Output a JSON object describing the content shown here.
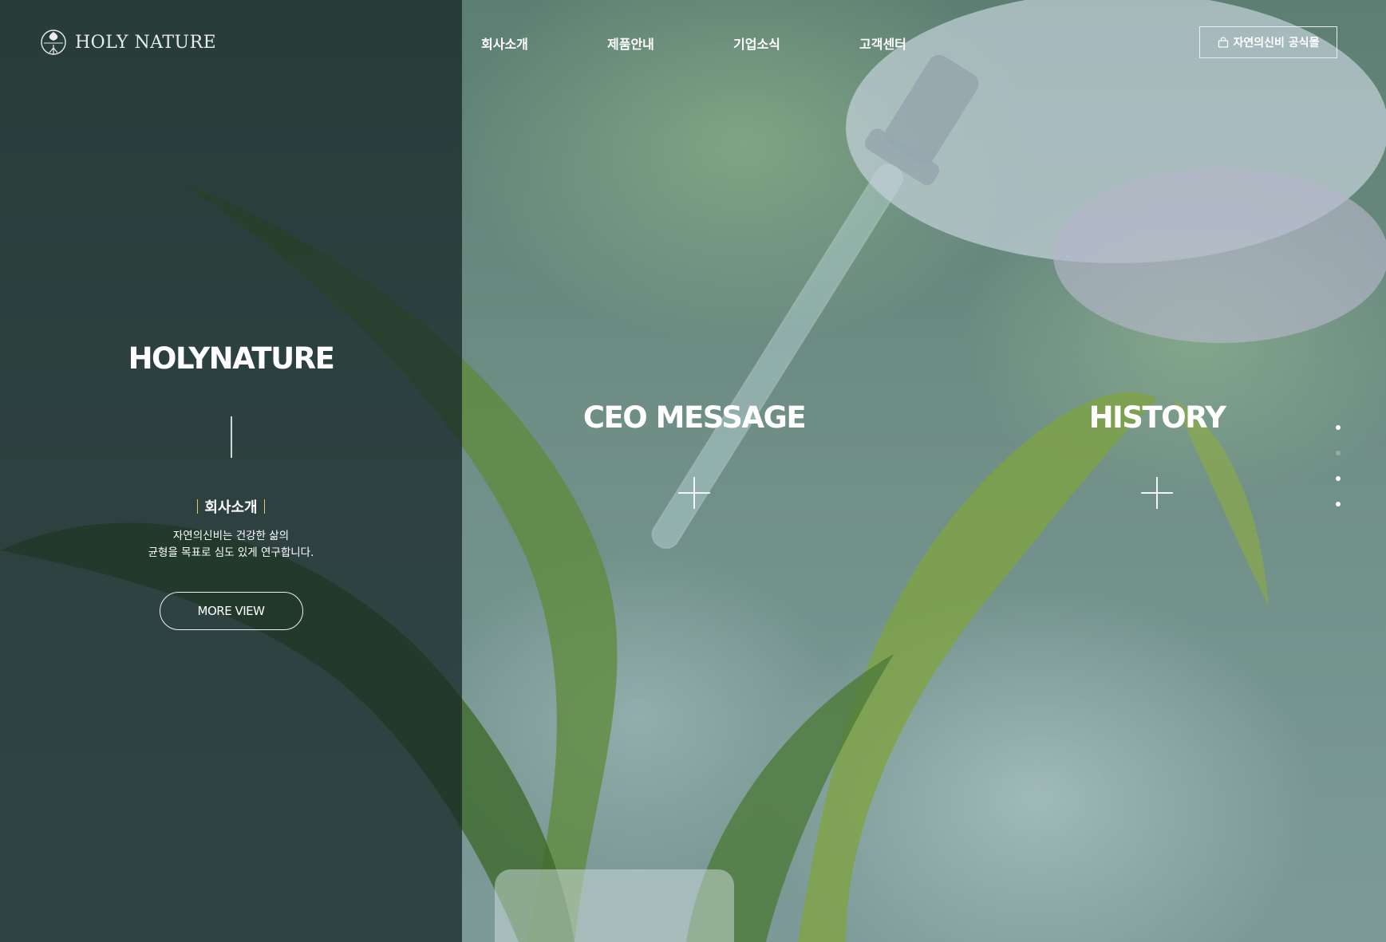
{
  "header": {
    "logo_text": "HOLY NATURE",
    "logo_mark_text": "HOLY NATURE",
    "nav": [
      "회사소개",
      "제품안내",
      "기업소식",
      "고객센터"
    ],
    "shop_button": "자연의신비 공식몰"
  },
  "left_panel": {
    "title": "HOLYNATURE",
    "sub_label": "회사소개",
    "desc_line1": "자연의신비는 건강한 삶의",
    "desc_line2": "균형을 목표로 심도 있게 연구합니다.",
    "button": "MORE VIEW"
  },
  "ceo": {
    "title": "CEO MESSAGE"
  },
  "history": {
    "title": "HISTORY"
  },
  "pagination": {
    "total": 4,
    "active_index": 1
  }
}
